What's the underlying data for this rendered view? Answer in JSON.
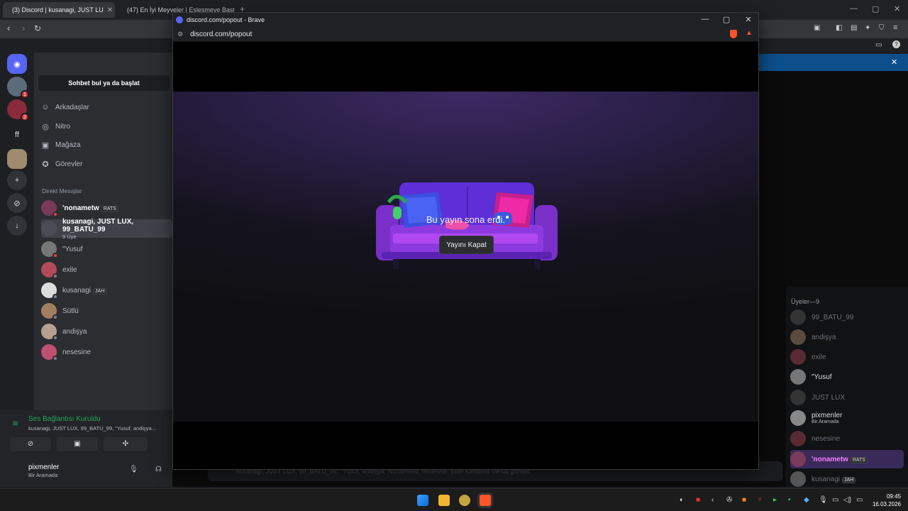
{
  "browser": {
    "tabs": [
      {
        "label": "(3) Discord | kusanagi, JUST LU"
      },
      {
        "label": "(47) En İyi Meyveler | Eşleşmeye Baştı"
      }
    ],
    "new_tab": "+"
  },
  "popout": {
    "window_title": "discord.com/popout - Brave",
    "url": "discord.com/popout",
    "message": "Bu yayın sona erdi.",
    "button_label": "Yayını Kapat"
  },
  "discord": {
    "search_label": "Sohbet bul ya da başlat",
    "nav": [
      {
        "label": "Arkadaşlar",
        "icon": "friends-icon"
      },
      {
        "label": "Nitro",
        "icon": "nitro-icon"
      },
      {
        "label": "Mağaza",
        "icon": "shop-icon"
      },
      {
        "label": "Görevler",
        "icon": "quests-icon"
      }
    ],
    "dm_section": "Direkt Mesajlar",
    "dms": [
      {
        "name": "'nonametw",
        "tag": "RATS",
        "sub": ""
      },
      {
        "name": "kusanagi, JUST LUX, 99_BATU_99",
        "tag": "",
        "sub": "9 Üye"
      },
      {
        "name": "\"Yusuf",
        "tag": "",
        "sub": ""
      },
      {
        "name": "exile",
        "tag": "",
        "sub": ""
      },
      {
        "name": "kusanagi",
        "tag": "JAH",
        "sub": ""
      },
      {
        "name": "Sütlü",
        "tag": "",
        "sub": ""
      },
      {
        "name": "andişya",
        "tag": "",
        "sub": ""
      },
      {
        "name": "nesesine",
        "tag": "",
        "sub": ""
      }
    ],
    "server_badges": [
      "1",
      "2"
    ],
    "server_ff": "ff",
    "voice": {
      "status": "Ses Bağlantısı Kuruldu",
      "channel": "kusanagi, JUST LUX, 99_BATU_99, \"Yusuf, andişya..."
    },
    "user": {
      "name": "pixmenler",
      "status": "Bir Aramada"
    },
    "members_header": "Üyeler—9",
    "members": [
      {
        "name": "99_BATU_99",
        "sub": ""
      },
      {
        "name": "andişya",
        "sub": ""
      },
      {
        "name": "exile",
        "sub": ""
      },
      {
        "name": "\"Yusuf",
        "sub": ""
      },
      {
        "name": "JUST LUX",
        "sub": ""
      },
      {
        "name": "pixmenler",
        "sub": "Bir Aramada"
      },
      {
        "name": "nesesine",
        "sub": ""
      },
      {
        "name": "'nonametw",
        "sub": "RATS"
      },
      {
        "name": "kusanagi",
        "sub": "JAH"
      }
    ],
    "chat_placeholder": "kusanagi, JUST LUX, 99_BATU_99, \"Yusuf, andişya, Nonametw, nesesine, exile kanalına mesaj gönder"
  },
  "taskbar": {
    "time": "09:45",
    "date": "16.03.2026"
  }
}
